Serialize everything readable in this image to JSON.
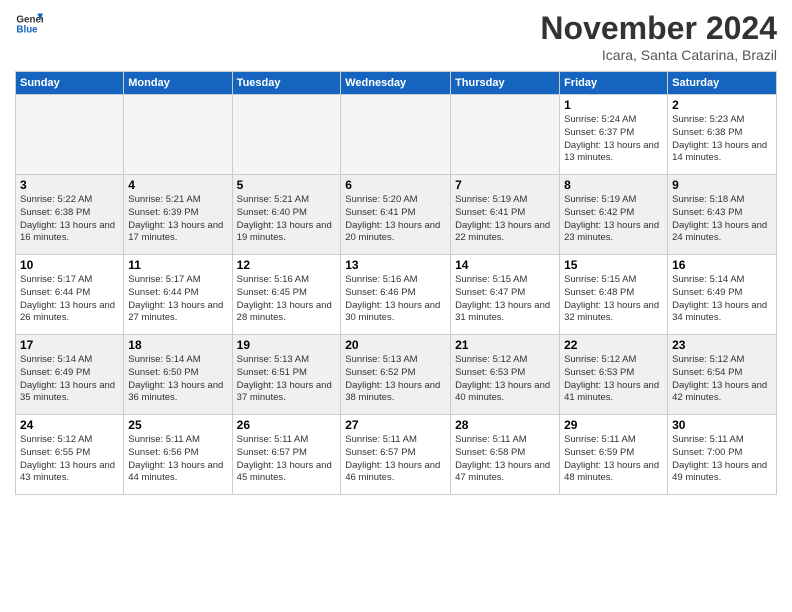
{
  "logo": {
    "line1": "General",
    "line2": "Blue"
  },
  "title": "November 2024",
  "location": "Icara, Santa Catarina, Brazil",
  "days_of_week": [
    "Sunday",
    "Monday",
    "Tuesday",
    "Wednesday",
    "Thursday",
    "Friday",
    "Saturday"
  ],
  "weeks": [
    [
      {
        "num": "",
        "empty": true
      },
      {
        "num": "",
        "empty": true
      },
      {
        "num": "",
        "empty": true
      },
      {
        "num": "",
        "empty": true
      },
      {
        "num": "",
        "empty": true
      },
      {
        "num": "1",
        "sunrise": "5:24 AM",
        "sunset": "6:37 PM",
        "daylight": "13 hours and 13 minutes."
      },
      {
        "num": "2",
        "sunrise": "5:23 AM",
        "sunset": "6:38 PM",
        "daylight": "13 hours and 14 minutes."
      }
    ],
    [
      {
        "num": "3",
        "sunrise": "5:22 AM",
        "sunset": "6:38 PM",
        "daylight": "13 hours and 16 minutes."
      },
      {
        "num": "4",
        "sunrise": "5:21 AM",
        "sunset": "6:39 PM",
        "daylight": "13 hours and 17 minutes."
      },
      {
        "num": "5",
        "sunrise": "5:21 AM",
        "sunset": "6:40 PM",
        "daylight": "13 hours and 19 minutes."
      },
      {
        "num": "6",
        "sunrise": "5:20 AM",
        "sunset": "6:41 PM",
        "daylight": "13 hours and 20 minutes."
      },
      {
        "num": "7",
        "sunrise": "5:19 AM",
        "sunset": "6:41 PM",
        "daylight": "13 hours and 22 minutes."
      },
      {
        "num": "8",
        "sunrise": "5:19 AM",
        "sunset": "6:42 PM",
        "daylight": "13 hours and 23 minutes."
      },
      {
        "num": "9",
        "sunrise": "5:18 AM",
        "sunset": "6:43 PM",
        "daylight": "13 hours and 24 minutes."
      }
    ],
    [
      {
        "num": "10",
        "sunrise": "5:17 AM",
        "sunset": "6:44 PM",
        "daylight": "13 hours and 26 minutes."
      },
      {
        "num": "11",
        "sunrise": "5:17 AM",
        "sunset": "6:44 PM",
        "daylight": "13 hours and 27 minutes."
      },
      {
        "num": "12",
        "sunrise": "5:16 AM",
        "sunset": "6:45 PM",
        "daylight": "13 hours and 28 minutes."
      },
      {
        "num": "13",
        "sunrise": "5:16 AM",
        "sunset": "6:46 PM",
        "daylight": "13 hours and 30 minutes."
      },
      {
        "num": "14",
        "sunrise": "5:15 AM",
        "sunset": "6:47 PM",
        "daylight": "13 hours and 31 minutes."
      },
      {
        "num": "15",
        "sunrise": "5:15 AM",
        "sunset": "6:48 PM",
        "daylight": "13 hours and 32 minutes."
      },
      {
        "num": "16",
        "sunrise": "5:14 AM",
        "sunset": "6:49 PM",
        "daylight": "13 hours and 34 minutes."
      }
    ],
    [
      {
        "num": "17",
        "sunrise": "5:14 AM",
        "sunset": "6:49 PM",
        "daylight": "13 hours and 35 minutes."
      },
      {
        "num": "18",
        "sunrise": "5:14 AM",
        "sunset": "6:50 PM",
        "daylight": "13 hours and 36 minutes."
      },
      {
        "num": "19",
        "sunrise": "5:13 AM",
        "sunset": "6:51 PM",
        "daylight": "13 hours and 37 minutes."
      },
      {
        "num": "20",
        "sunrise": "5:13 AM",
        "sunset": "6:52 PM",
        "daylight": "13 hours and 38 minutes."
      },
      {
        "num": "21",
        "sunrise": "5:12 AM",
        "sunset": "6:53 PM",
        "daylight": "13 hours and 40 minutes."
      },
      {
        "num": "22",
        "sunrise": "5:12 AM",
        "sunset": "6:53 PM",
        "daylight": "13 hours and 41 minutes."
      },
      {
        "num": "23",
        "sunrise": "5:12 AM",
        "sunset": "6:54 PM",
        "daylight": "13 hours and 42 minutes."
      }
    ],
    [
      {
        "num": "24",
        "sunrise": "5:12 AM",
        "sunset": "6:55 PM",
        "daylight": "13 hours and 43 minutes."
      },
      {
        "num": "25",
        "sunrise": "5:11 AM",
        "sunset": "6:56 PM",
        "daylight": "13 hours and 44 minutes."
      },
      {
        "num": "26",
        "sunrise": "5:11 AM",
        "sunset": "6:57 PM",
        "daylight": "13 hours and 45 minutes."
      },
      {
        "num": "27",
        "sunrise": "5:11 AM",
        "sunset": "6:57 PM",
        "daylight": "13 hours and 46 minutes."
      },
      {
        "num": "28",
        "sunrise": "5:11 AM",
        "sunset": "6:58 PM",
        "daylight": "13 hours and 47 minutes."
      },
      {
        "num": "29",
        "sunrise": "5:11 AM",
        "sunset": "6:59 PM",
        "daylight": "13 hours and 48 minutes."
      },
      {
        "num": "30",
        "sunrise": "5:11 AM",
        "sunset": "7:00 PM",
        "daylight": "13 hours and 49 minutes."
      }
    ]
  ]
}
